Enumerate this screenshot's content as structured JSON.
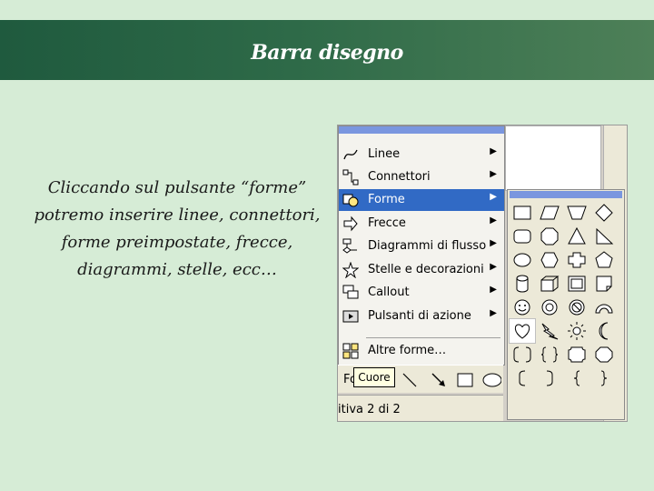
{
  "slide": {
    "title": "Barra disegno",
    "body_lines": [
      "Cliccando sul pulsante “forme”",
      "potremo inserire linee, connettori,",
      "forme preimpostate, frecce,",
      "diagrammi, stelle, ecc…"
    ]
  },
  "menu": {
    "items": [
      {
        "label": "Linee",
        "icon": "lines-icon",
        "arrow": "▶"
      },
      {
        "label": "Connettori",
        "icon": "connectors-icon",
        "arrow": "▶"
      },
      {
        "label": "Forme",
        "icon": "basic-shapes-icon",
        "arrow": "▶"
      },
      {
        "label": "Frecce",
        "icon": "block-arrows-icon",
        "arrow": "▶"
      },
      {
        "label": "Diagrammi di flusso",
        "icon": "flowchart-icon",
        "arrow": "▶"
      },
      {
        "label": "Stelle e decorazioni",
        "icon": "stars-banners-icon",
        "arrow": "▶"
      },
      {
        "label": "Callout",
        "icon": "callouts-icon",
        "arrow": "▶"
      },
      {
        "label": "Pulsanti di azione",
        "icon": "action-buttons-icon",
        "arrow": "▶"
      },
      {
        "label": "Altre forme…",
        "icon": "more-shapes-icon",
        "arrow": ""
      }
    ],
    "highlight_color": "#316ac5"
  },
  "toolbar": {
    "forme_label": "Forme ▾"
  },
  "status": {
    "text": "itiva 2 di 2"
  },
  "tooltip": {
    "text": "Cuore"
  },
  "colors": {
    "slide_bg": "#d6ecd6",
    "title_bar": "#2e6a48"
  }
}
